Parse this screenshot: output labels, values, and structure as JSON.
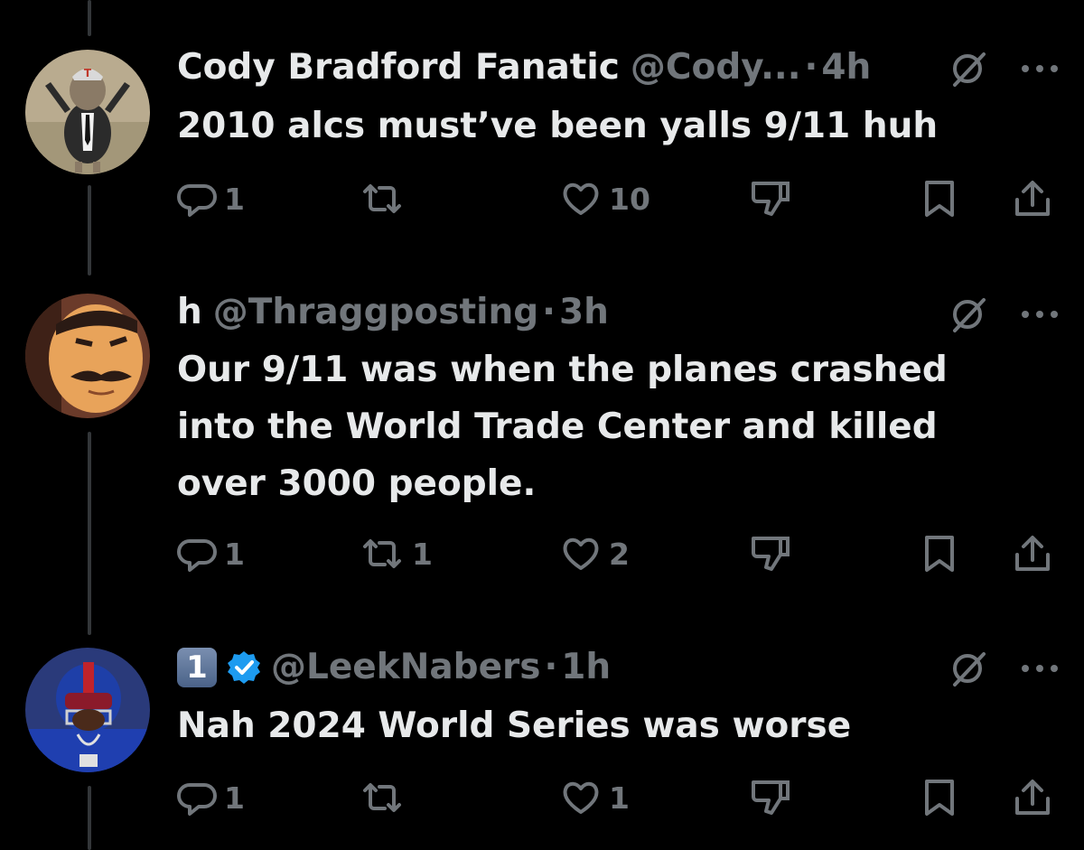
{
  "tweets": [
    {
      "display_name": "Cody Bradford Fanatic",
      "handle": "@Cody...",
      "separator": "·",
      "time": "4h",
      "text": "2010 alcs must’ve been yalls 9/11 huh",
      "replies": "1",
      "reposts": "",
      "likes": "10"
    },
    {
      "display_name": "h",
      "handle": "@Thraggposting",
      "separator": "·",
      "time": "3h",
      "text": "Our 9/11 was when the planes crashed into the World Trade Center and killed over 3000 people.",
      "replies": "1",
      "reposts": "1",
      "likes": "2"
    },
    {
      "display_name": "1",
      "handle": "@LeekNabers",
      "separator": "·",
      "time": "1h",
      "text": "Nah 2024 World Series was worse",
      "replies": "1",
      "reposts": "",
      "likes": "1"
    }
  ],
  "colors": {
    "background": "#000000",
    "text": "#e7e9ea",
    "muted": "#71767b",
    "verified": "#1d9bf0"
  },
  "icons": [
    "grok-icon",
    "more-icon",
    "reply-icon",
    "repost-icon",
    "like-icon",
    "dislike-icon",
    "bookmark-icon",
    "share-icon",
    "verified-icon"
  ]
}
